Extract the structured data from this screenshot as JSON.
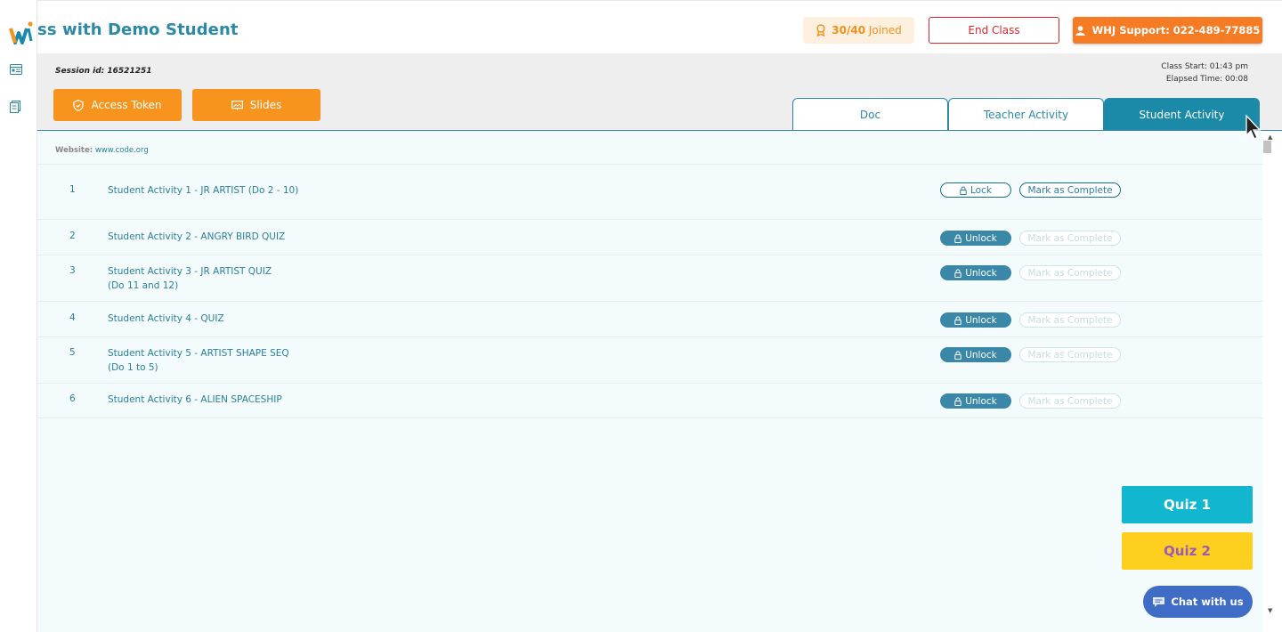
{
  "header": {
    "title": "ss with Demo Student",
    "joined": {
      "count": "30/40",
      "label": "Joined"
    },
    "end_class_label": "End Class",
    "support_label": "WHJ Support: 022-489-77885"
  },
  "session": {
    "session_label": "Session id:",
    "session_id": "16521251",
    "class_start": "Class Start: 01:43 pm",
    "elapsed": "Elapsed Time: 00:08"
  },
  "toolbar": {
    "access_token_label": "Access Token",
    "slides_label": "Slides"
  },
  "tabs": [
    {
      "label": "Doc",
      "active": false
    },
    {
      "label": "Teacher Activity",
      "active": false
    },
    {
      "label": "Student Activity",
      "active": true
    }
  ],
  "website": {
    "key": "Website:",
    "value": "www.code.org"
  },
  "activities": [
    {
      "num": "1",
      "title": "Student Activity 1 - JR ARTIST (Do 2 - 10)",
      "lock_label": "Lock",
      "complete_label": "Mark as Complete"
    },
    {
      "num": "2",
      "title": "Student Activity 2 - ANGRY BIRD QUIZ",
      "lock_label": "Unlock",
      "complete_label": "Mark as Complete"
    },
    {
      "num": "3",
      "title": "Student Activity 3 - JR ARTIST QUIZ (Do 11 and 12)",
      "lock_label": "Unlock",
      "complete_label": "Mark as Complete"
    },
    {
      "num": "4",
      "title": "Student Activity 4 - QUIZ",
      "lock_label": "Unlock",
      "complete_label": "Mark as Complete"
    },
    {
      "num": "5",
      "title": "Student Activity 5 - ARTIST SHAPE SEQ (Do 1 to 5)",
      "lock_label": "Unlock",
      "complete_label": "Mark as Complete"
    },
    {
      "num": "6",
      "title": "Student Activity 6 - ALIEN SPACESHIP",
      "lock_label": "Unlock",
      "complete_label": "Mark as Complete"
    }
  ],
  "quizzes": {
    "quiz1": "Quiz 1",
    "quiz2": "Quiz 2"
  },
  "chat_label": "Chat with us",
  "colors": {
    "brand_teal": "#2b89a5",
    "orange": "#f7941d",
    "support_orange": "#f57c25",
    "danger": "#d9252b",
    "quiz1": "#12b6cf",
    "quiz2": "#fdd020",
    "chat": "#3f6cc4"
  }
}
